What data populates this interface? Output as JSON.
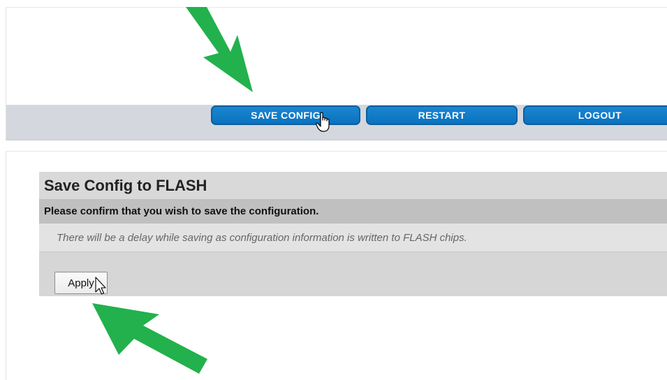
{
  "top": {
    "nav_buttons": [
      {
        "label": "SAVE CONFIG"
      },
      {
        "label": "RESTART"
      },
      {
        "label": "LOGOUT"
      }
    ]
  },
  "dialog": {
    "title": "Save Config to FLASH",
    "confirm_text": "Please confirm that you wish to save the configuration.",
    "note": "There will be a delay while saving as configuration information is written to FLASH chips.",
    "apply_label": "Apply"
  },
  "colors": {
    "nav_button": "#0a72bf",
    "nav_bar": "#d4d7de",
    "annotation_arrow": "#22b14c"
  },
  "icons": [
    "hand-pointer-icon",
    "arrow-pointer-icon",
    "green-annotation-arrow"
  ]
}
